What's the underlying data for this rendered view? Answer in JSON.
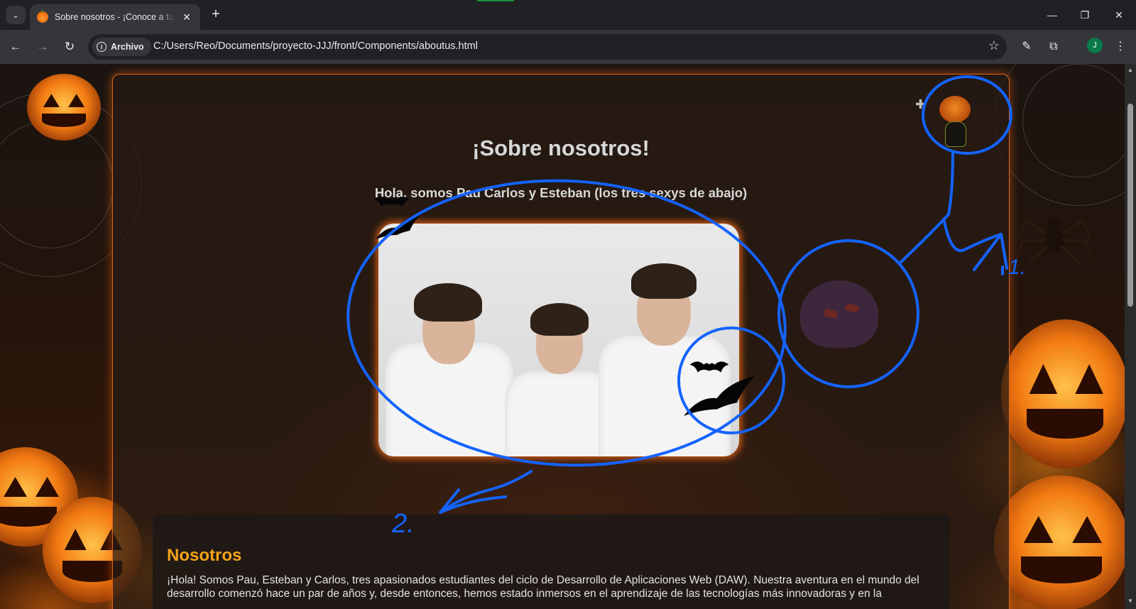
{
  "browser": {
    "tab_title": "Sobre nosotros - ¡Conoce a tus",
    "site_chip_label": "Archivo",
    "url": "C:/Users/Reo/Documents/proyecto-JJJ/front/Components/aboutus.html",
    "profile_initial": "J"
  },
  "page": {
    "title": "¡Sobre nosotros!",
    "subtitle": "Hola, somos Pau Carlos y Esteban (los tres sexys de abajo)",
    "section_title": "Nosotros",
    "section_text": "¡Hola! Somos Pau, Esteban y Carlos, tres apasionados estudiantes del ciclo de Desarrollo de Aplicaciones Web (DAW). Nuestra aventura en el mundo del desarrollo comenzó hace un par de años y, desde entonces, hemos estado inmersos en el aprendizaje de las tecnologías más innovadoras y en la"
  },
  "annotations": {
    "marker_1": "1.",
    "marker_2": "2."
  },
  "colors": {
    "accent_orange": "#d9651c",
    "section_title": "#f2a31a",
    "annotation_blue": "#1463ff"
  },
  "icons": [
    "tab-list-icon",
    "pumpkin-favicon",
    "close-icon",
    "plus-icon",
    "minimize-icon",
    "restore-icon",
    "window-close-icon",
    "back-icon",
    "forward-icon",
    "reload-icon",
    "info-icon",
    "star-icon",
    "eyedropper-icon",
    "extensions-icon",
    "menu-icon"
  ]
}
